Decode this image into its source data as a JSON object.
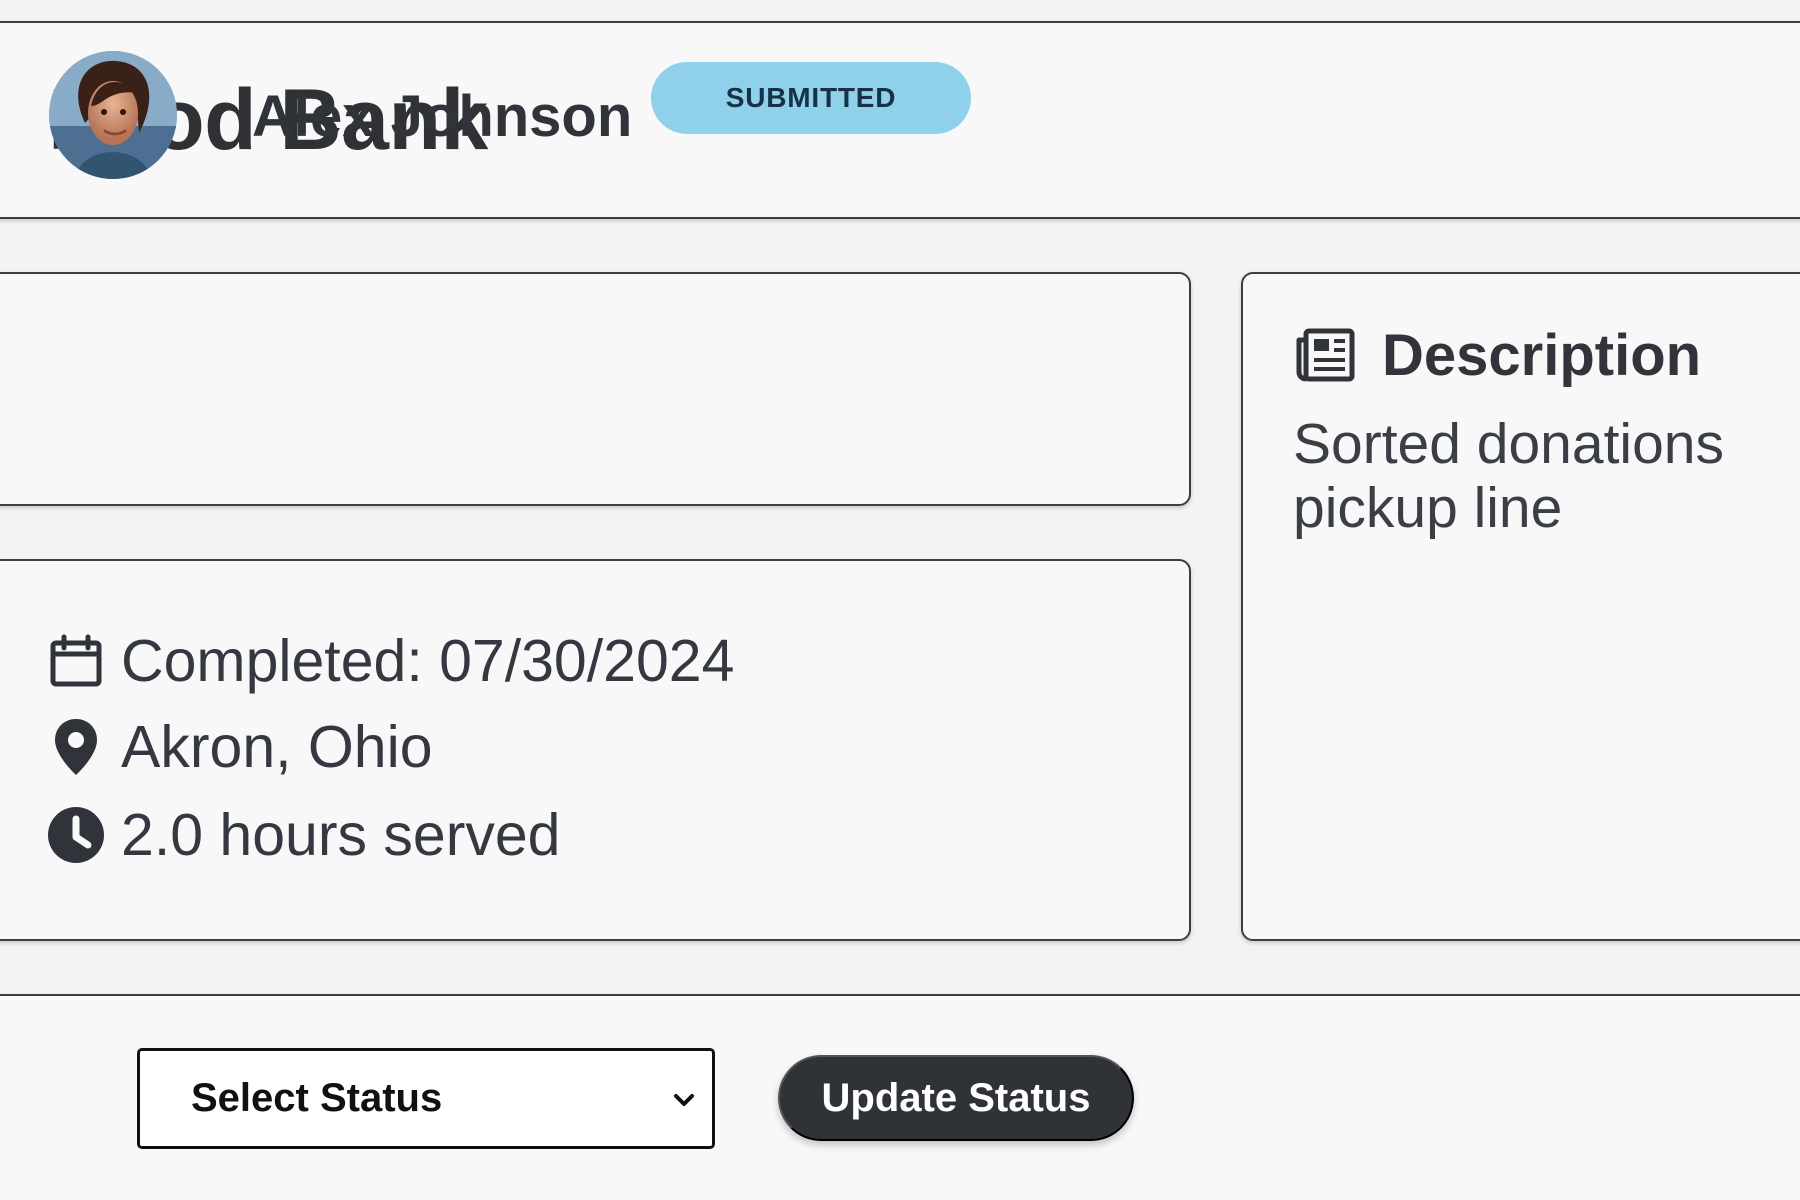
{
  "header": {
    "title": "Food Bank",
    "status_badge": "SUBMITTED"
  },
  "volunteer": {
    "name": "Alex Johnson",
    "avatar_icon": "person-avatar"
  },
  "details": {
    "completed": "Completed: 07/30/2024",
    "location": "Akron, Ohio",
    "hours": "2.0 hours served",
    "icons": [
      "calendar-icon",
      "map-pin-icon",
      "clock-icon"
    ]
  },
  "description": {
    "title": "Description",
    "text_line_1": "Sorted donations",
    "text_line_2": "pickup line",
    "icon": "newspaper-icon"
  },
  "actions": {
    "select_status": "Select Status",
    "update_button": "Update Status"
  },
  "colors": {
    "badge": "#8fd1ea",
    "dark_button": "#2f3338",
    "panel": "#f8f8f8"
  }
}
